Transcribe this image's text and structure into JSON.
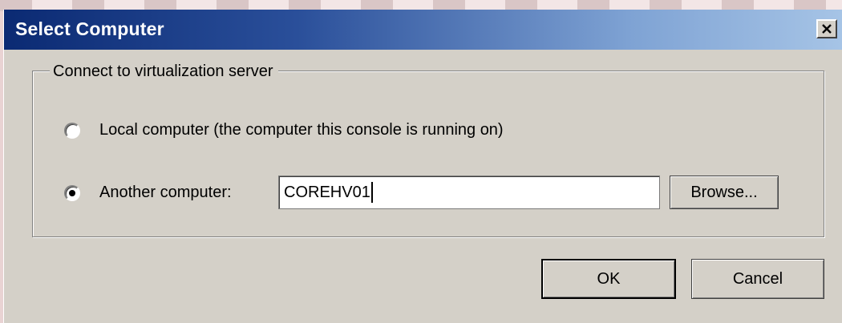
{
  "window": {
    "title": "Select Computer",
    "close_label": "X"
  },
  "group": {
    "legend": "Connect to virtualization server"
  },
  "options": {
    "local": {
      "label": "Local computer (the computer this console is running on)",
      "selected": false
    },
    "another": {
      "label": "Another computer:",
      "selected": true
    }
  },
  "computer_input": {
    "value": "COREHV01"
  },
  "buttons": {
    "browse": "Browse...",
    "ok": "OK",
    "cancel": "Cancel"
  }
}
